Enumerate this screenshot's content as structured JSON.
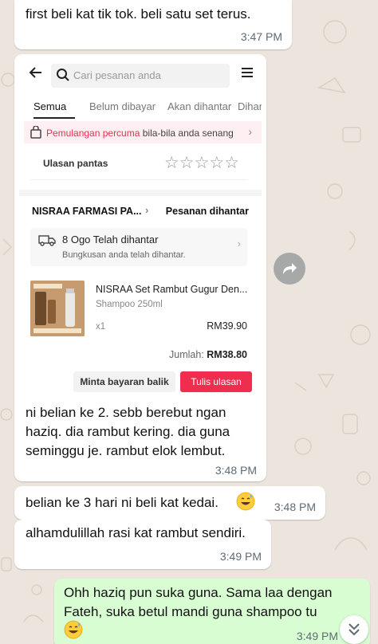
{
  "colors": {
    "chat_background": "#ece5dd",
    "incoming_bubble": "#ffffff",
    "outgoing_bubble": "#d9fdd3",
    "shop_accent": "#ee2d4f",
    "timestamp": "#5f6b73"
  },
  "messages": [
    {
      "direction": "incoming",
      "text": "first beli kat tik tok. beli satu set terus.",
      "time": "3:47 PM"
    },
    {
      "direction": "incoming",
      "text": "ni belian ke 2. sebb berebut ngan haziq. dia rambut kering.   dia guna seminggu je. rambut elok lembut.",
      "time": "3:48 PM"
    },
    {
      "direction": "incoming",
      "text": "belian ke 3 hari ni beli kat kedai.",
      "emoji": "grinning-face-with-sweat",
      "time": "3:48 PM"
    },
    {
      "direction": "incoming",
      "text": "alhamdulillah rasi kat rambut sendiri.",
      "time": "3:49 PM"
    },
    {
      "direction": "outgoing",
      "text": "Ohh haziq pun suka guna. Sama laa dengan Fateh, suka betul mandi guna shampoo tu",
      "emoji": "grinning-face-with-sweat",
      "time": "3:49 PM"
    }
  ],
  "shop_screenshot": {
    "search_placeholder": "Cari pesanan anda",
    "tabs": [
      "Semua",
      "Belum dibayar",
      "Akan dihantar",
      "Dihan"
    ],
    "active_tab": "Semua",
    "promo_highlight": "Pemulangan percuma",
    "promo_rest": " bila-bila anda senang",
    "quick_review_label": "Ulasan pantas",
    "star_rating": 0,
    "star_count": 5,
    "shop_name": "NISRAA FARMASI PA...",
    "order_status": "Pesanan dihantar",
    "delivery_title": "8 Ogo Telah dihantar",
    "delivery_subtitle": "Bungkusan anda telah dihantar.",
    "product_name": "NISRAA Set Rambut Gugur Den...",
    "product_variant": "Shampoo 250ml",
    "product_qty": "x1",
    "product_price": "RM39.90",
    "total_label": "Jumlah: ",
    "total_value": "RM38.80",
    "refund_button": "Minta bayaran balik",
    "review_button": "Tulis ulasan"
  }
}
